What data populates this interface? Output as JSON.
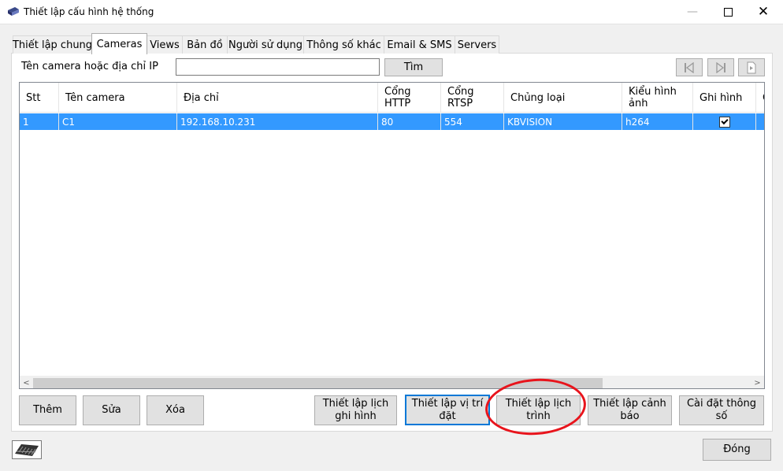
{
  "window": {
    "title": "Thiết lập cấu hình hệ thống",
    "icons": {
      "app": "camera-app-icon",
      "minimize": "minimize-icon",
      "maximize": "maximize-icon",
      "close": "close-icon"
    }
  },
  "tabs": [
    {
      "label": "Thiết lập chung",
      "active": false
    },
    {
      "label": "Cameras",
      "active": true
    },
    {
      "label": "Views",
      "active": false
    },
    {
      "label": "Bản đồ",
      "active": false
    },
    {
      "label": "Người sử dụng",
      "active": false
    },
    {
      "label": "Thông số khác",
      "active": false
    },
    {
      "label": "Email & SMS",
      "active": false
    },
    {
      "label": "Servers",
      "active": false
    }
  ],
  "search": {
    "label": "Tên camera hoặc địa chỉ IP",
    "value": "",
    "button_label": "Tìm"
  },
  "nav_icons": [
    "first-page-icon",
    "last-page-icon",
    "export-icon"
  ],
  "grid": {
    "columns": [
      "Stt",
      "Tên camera",
      "Địa chỉ",
      "Cổng\nHTTP",
      "Cổng\nRTSP",
      "Chủng loại",
      "Kiểu hình\nảnh",
      "Ghi hình",
      "C"
    ],
    "rows": [
      {
        "stt": "1",
        "name": "C1",
        "address": "192.168.10.231",
        "http": "80",
        "rtsp": "554",
        "type": "KBVISION",
        "format": "h264",
        "record": true
      }
    ],
    "scroll_left": "<",
    "scroll_right": ">"
  },
  "actions": {
    "add": "Thêm",
    "edit": "Sửa",
    "delete": "Xóa",
    "record_schedule": "Thiết lập lịch\nghi hình",
    "location": "Thiết lập vị trí\nđặt",
    "schedule": "Thiết lập lịch\ntrình",
    "alert": "Thiết lập cảnh\nbáo",
    "settings": "Cài đặt thông\nsố"
  },
  "footer": {
    "close_label": "Đóng",
    "keyboard_icon": "keyboard-icon"
  },
  "colors": {
    "selection": "#3399ff",
    "annotation": "#e8141c",
    "focus_border": "#0078d7"
  }
}
